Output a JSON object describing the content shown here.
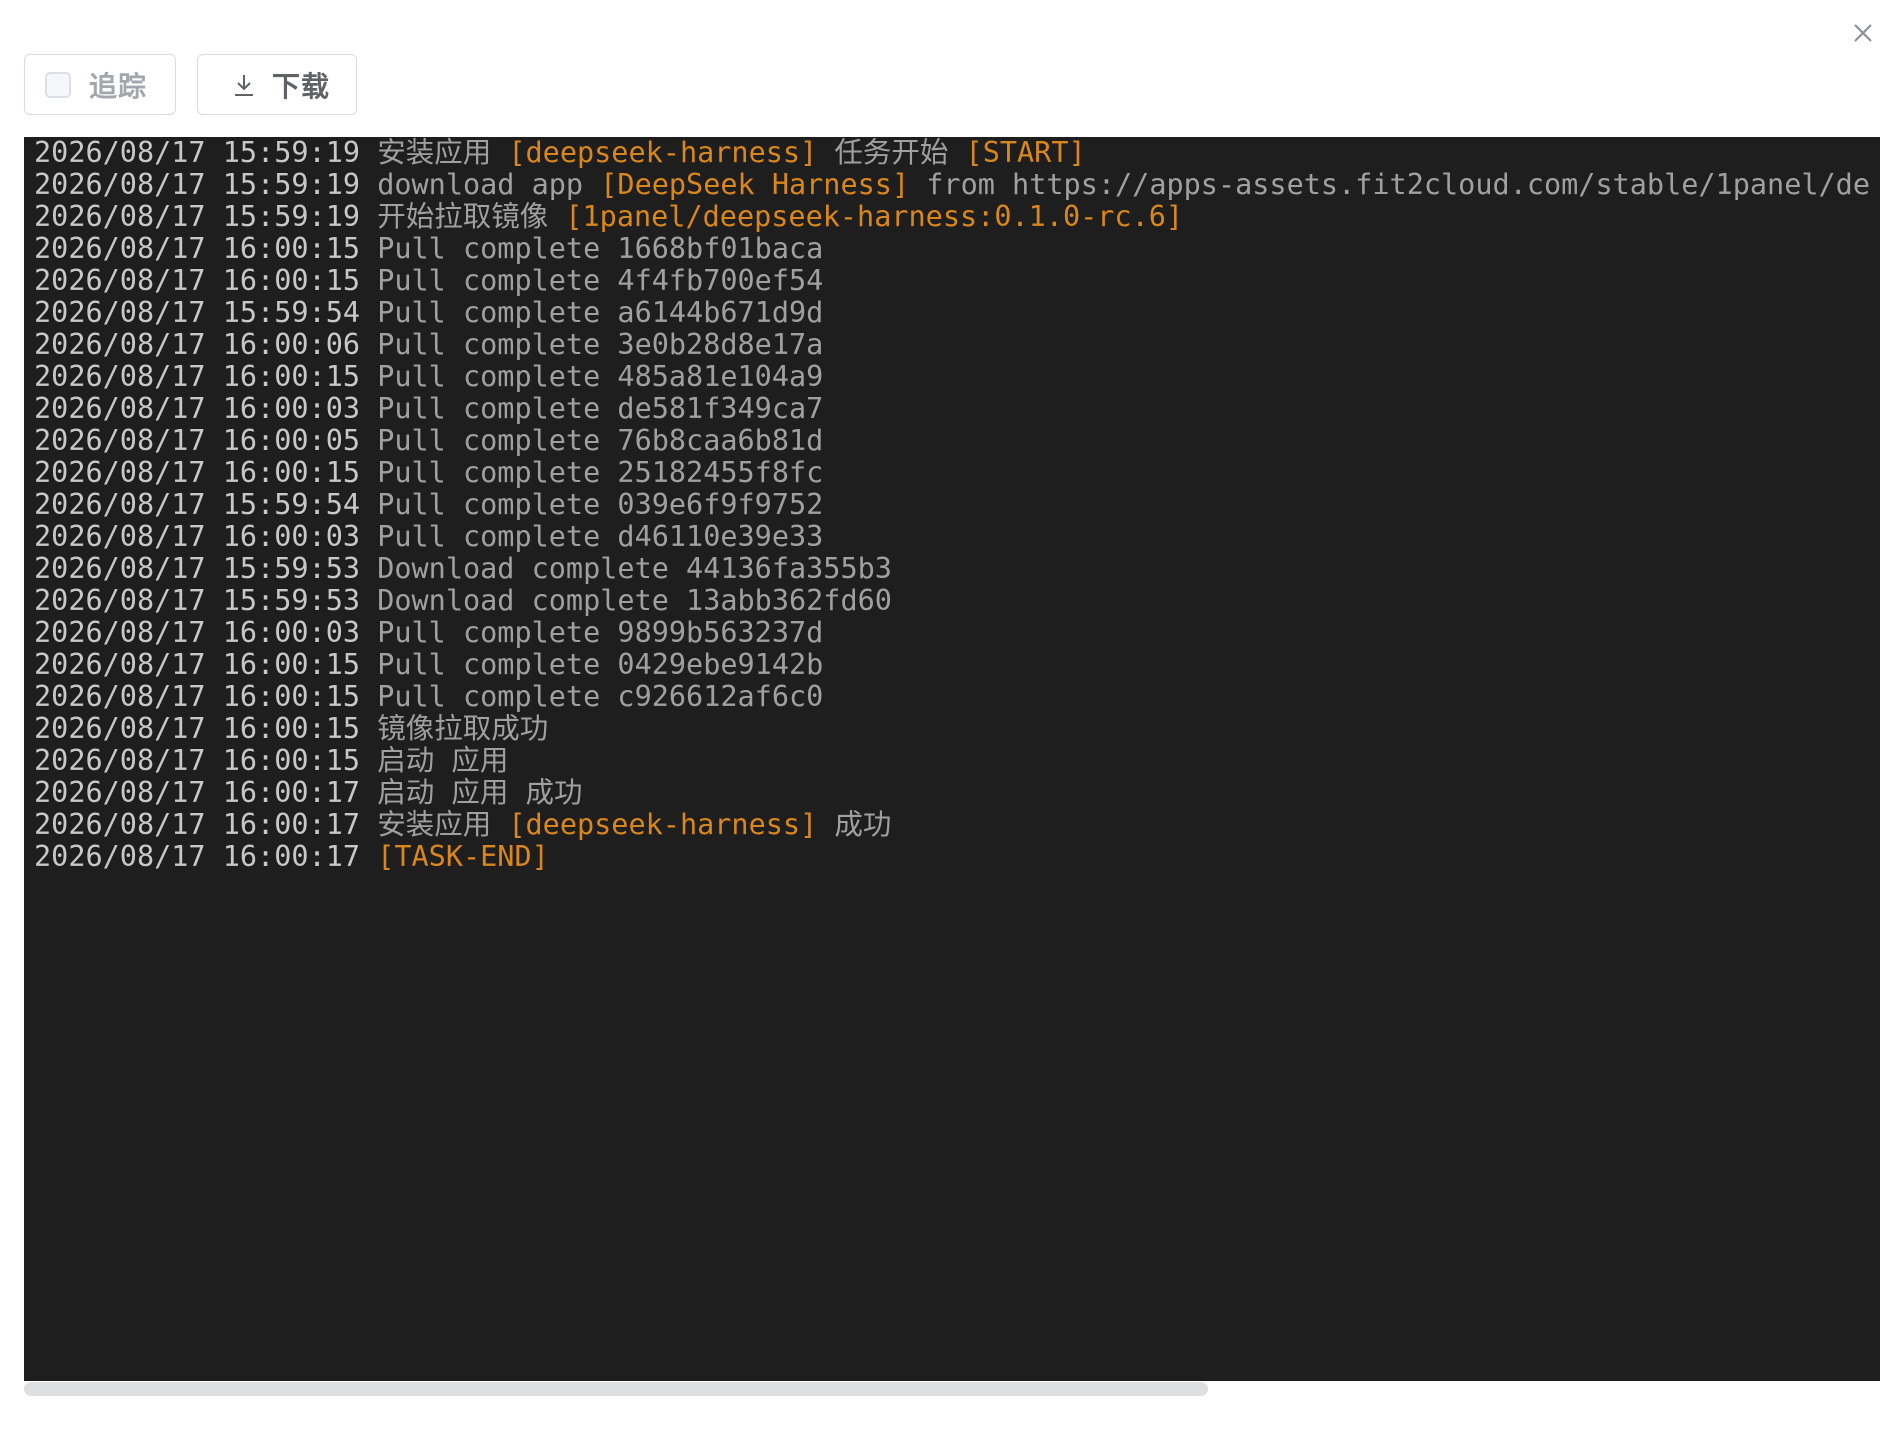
{
  "toolbar": {
    "follow_label": "追踪",
    "download_label": "下载"
  },
  "colors": {
    "terminal_bg": "#1e1e1e",
    "highlight": "#d9861d",
    "timestamp": "#c8c8c8",
    "text": "#a0a0a0"
  },
  "icons": {
    "close": "close-icon",
    "download": "download-icon",
    "checkbox": "checkbox-unchecked"
  },
  "log": [
    {
      "ts": "2026/08/17 15:59:19",
      "parts": [
        {
          "t": "安装应用 "
        },
        {
          "t": "[deepseek-harness]",
          "hl": true
        },
        {
          "t": " 任务开始 "
        },
        {
          "t": "[START]",
          "hl": true
        }
      ]
    },
    {
      "ts": "2026/08/17 15:59:19",
      "parts": [
        {
          "t": "download app "
        },
        {
          "t": "[DeepSeek Harness]",
          "hl": true
        },
        {
          "t": " from https://apps-assets.fit2cloud.com/stable/1panel/de"
        }
      ]
    },
    {
      "ts": "2026/08/17 15:59:19",
      "parts": [
        {
          "t": "开始拉取镜像 "
        },
        {
          "t": "[1panel/deepseek-harness:0.1.0-rc.6]",
          "hl": true
        }
      ]
    },
    {
      "ts": "2026/08/17 16:00:15",
      "parts": [
        {
          "t": "Pull complete 1668bf01baca"
        }
      ]
    },
    {
      "ts": "2026/08/17 16:00:15",
      "parts": [
        {
          "t": "Pull complete 4f4fb700ef54"
        }
      ]
    },
    {
      "ts": "2026/08/17 15:59:54",
      "parts": [
        {
          "t": "Pull complete a6144b671d9d"
        }
      ]
    },
    {
      "ts": "2026/08/17 16:00:06",
      "parts": [
        {
          "t": "Pull complete 3e0b28d8e17a"
        }
      ]
    },
    {
      "ts": "2026/08/17 16:00:15",
      "parts": [
        {
          "t": "Pull complete 485a81e104a9"
        }
      ]
    },
    {
      "ts": "2026/08/17 16:00:03",
      "parts": [
        {
          "t": "Pull complete de581f349ca7"
        }
      ]
    },
    {
      "ts": "2026/08/17 16:00:05",
      "parts": [
        {
          "t": "Pull complete 76b8caa6b81d"
        }
      ]
    },
    {
      "ts": "2026/08/17 16:00:15",
      "parts": [
        {
          "t": "Pull complete 25182455f8fc"
        }
      ]
    },
    {
      "ts": "2026/08/17 15:59:54",
      "parts": [
        {
          "t": "Pull complete 039e6f9f9752"
        }
      ]
    },
    {
      "ts": "2026/08/17 16:00:03",
      "parts": [
        {
          "t": "Pull complete d46110e39e33"
        }
      ]
    },
    {
      "ts": "2026/08/17 15:59:53",
      "parts": [
        {
          "t": "Download complete 44136fa355b3"
        }
      ]
    },
    {
      "ts": "2026/08/17 15:59:53",
      "parts": [
        {
          "t": "Download complete 13abb362fd60"
        }
      ]
    },
    {
      "ts": "2026/08/17 16:00:03",
      "parts": [
        {
          "t": "Pull complete 9899b563237d"
        }
      ]
    },
    {
      "ts": "2026/08/17 16:00:15",
      "parts": [
        {
          "t": "Pull complete 0429ebe9142b"
        }
      ]
    },
    {
      "ts": "2026/08/17 16:00:15",
      "parts": [
        {
          "t": "Pull complete c926612af6c0"
        }
      ]
    },
    {
      "ts": "2026/08/17 16:00:15",
      "parts": [
        {
          "t": "镜像拉取成功"
        }
      ]
    },
    {
      "ts": "2026/08/17 16:00:15",
      "parts": [
        {
          "t": "启动 应用"
        }
      ]
    },
    {
      "ts": "2026/08/17 16:00:17",
      "parts": [
        {
          "t": "启动 应用 成功"
        }
      ]
    },
    {
      "ts": "2026/08/17 16:00:17",
      "parts": [
        {
          "t": "安装应用 "
        },
        {
          "t": "[deepseek-harness]",
          "hl": true
        },
        {
          "t": " 成功"
        }
      ]
    },
    {
      "ts": "2026/08/17 16:00:17",
      "parts": [
        {
          "t": "[TASK-END]",
          "hl": true
        }
      ]
    }
  ]
}
